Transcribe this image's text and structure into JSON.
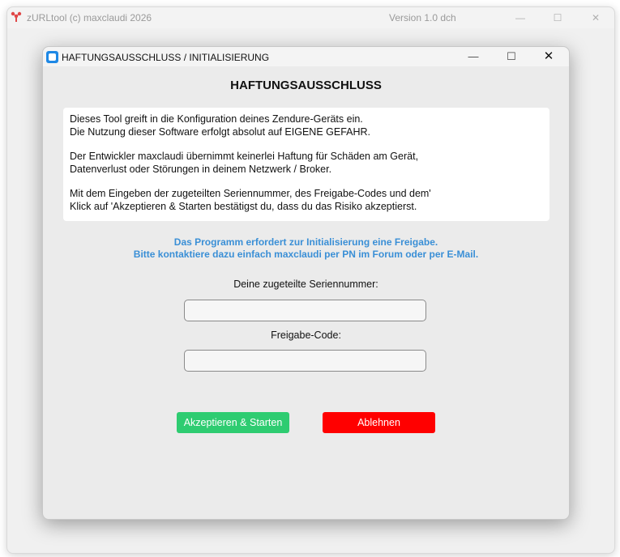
{
  "main_window": {
    "title": "zURLtool (c) maxclaudi 2026",
    "version": "Version 1.0 dch",
    "controls": {
      "minimize": "—",
      "maximize": "☐",
      "close": "✕"
    }
  },
  "dialog": {
    "title": "HAFTUNGSAUSSCHLUSS / INITIALISIERUNG",
    "controls": {
      "minimize": "—",
      "maximize": "☐",
      "close": "✕"
    },
    "heading": "HAFTUNGSAUSSCHLUSS",
    "disclaimer": {
      "line1": "Dieses Tool greift in die Konfiguration deines Zendure-Geräts ein.",
      "line2": "Die Nutzung dieser Software erfolgt absolut auf EIGENE GEFAHR.",
      "line3": "Der Entwickler maxclaudi übernimmt keinerlei Haftung für Schäden am Gerät,",
      "line4": "Datenverlust oder Störungen in deinem Netzwerk / Broker.",
      "line5": "Mit dem Eingeben der zugeteilten Seriennummer, des Freigabe-Codes und dem'",
      "line6": "Klick auf 'Akzeptieren & Starten bestätigst du, dass du das Risiko akzeptierst."
    },
    "info": {
      "line1": "Das Programm erfordert zur Initialisierung eine Freigabe.",
      "line2": "Bitte kontaktiere dazu einfach maxclaudi per PN im Forum oder per E-Mail."
    },
    "serial_label": "Deine zugeteilte Seriennummer:",
    "serial_value": "",
    "code_label": "Freigabe-Code:",
    "code_value": "",
    "accept_button": "Akzeptieren & Starten",
    "reject_button": "Ablehnen"
  },
  "colors": {
    "accept": "#2ecc71",
    "reject": "#ff0000",
    "info_text": "#3a8fd6"
  }
}
